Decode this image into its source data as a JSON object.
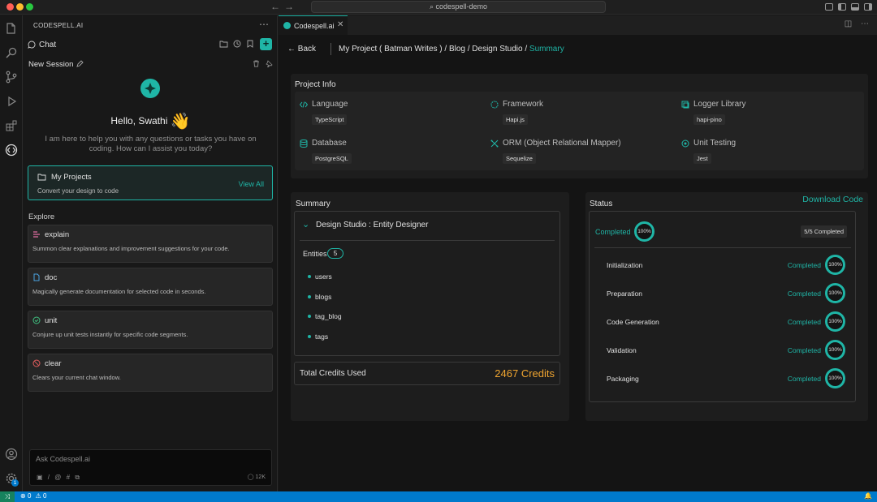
{
  "window": {
    "search": "codespell-demo"
  },
  "sidebar": {
    "header": "CODESPELL.AI",
    "chat_label": "Chat",
    "session_label": "New Session",
    "greeting": "Hello, Swathi",
    "greeting_emoji": "👋",
    "intro": "I am here to help you with any questions or tasks you have on coding. How can I assist you today?",
    "projects": {
      "title": "My Projects",
      "subtitle": "Convert your design to code",
      "view_all": "View All"
    },
    "explore_label": "Explore",
    "commands": [
      {
        "name": "explain",
        "desc": "Summon clear explanations and improvement suggestions for your code."
      },
      {
        "name": "doc",
        "desc": "Magically generate documentation for selected code in seconds."
      },
      {
        "name": "unit",
        "desc": "Conjure up unit tests instantly for specific code segments."
      },
      {
        "name": "clear",
        "desc": "Clears your current chat window."
      }
    ],
    "ask": {
      "placeholder": "Ask Codespell.ai",
      "count": "12K"
    }
  },
  "tab": {
    "label": "Codespell.ai"
  },
  "nav": {
    "back": "Back",
    "breadcrumb": "My Project ( Batman Writes ) / Blog / Design Studio /",
    "breadcrumb_active": "Summary"
  },
  "project_info": {
    "title": "Project Info",
    "items": [
      {
        "label": "Language",
        "value": "TypeScript",
        "icon": "code-icon"
      },
      {
        "label": "Framework",
        "value": "Hapi.js",
        "icon": "framework-icon"
      },
      {
        "label": "Logger Library",
        "value": "hapi-pino",
        "icon": "library-icon"
      },
      {
        "label": "Database",
        "value": "PostgreSQL",
        "icon": "database-icon"
      },
      {
        "label": "ORM (Object Relational Mapper)",
        "value": "Sequelize",
        "icon": "orm-icon"
      },
      {
        "label": "Unit Testing",
        "value": "Jest",
        "icon": "test-icon"
      }
    ]
  },
  "summary": {
    "title": "Summary",
    "section_title": "Design Studio : Entity Designer",
    "entities_label": "Entities",
    "entities_count": "5",
    "entities": [
      "users",
      "blogs",
      "tag_blog",
      "tags"
    ],
    "credits_label": "Total Credits Used",
    "credits_value": "2467 Credits"
  },
  "status": {
    "title": "Status",
    "download": "Download Code",
    "overall_status": "Completed",
    "overall_percent": "100%",
    "overall_progress": 1.0,
    "completed_count": "5/5 Completed",
    "steps": [
      {
        "name": "Initialization",
        "status": "Completed",
        "percent": "100%"
      },
      {
        "name": "Preparation",
        "status": "Completed",
        "percent": "100%"
      },
      {
        "name": "Code Generation",
        "status": "Completed",
        "percent": "100%"
      },
      {
        "name": "Validation",
        "status": "Completed",
        "percent": "100%"
      },
      {
        "name": "Packaging",
        "status": "Completed",
        "percent": "100%"
      }
    ]
  },
  "statusbar": {
    "errors": "0",
    "warnings": "0",
    "settings_badge": "1"
  },
  "colors": {
    "accent": "#1fb5a6",
    "credits": "#f0a530",
    "statusbar": "#007acc"
  }
}
